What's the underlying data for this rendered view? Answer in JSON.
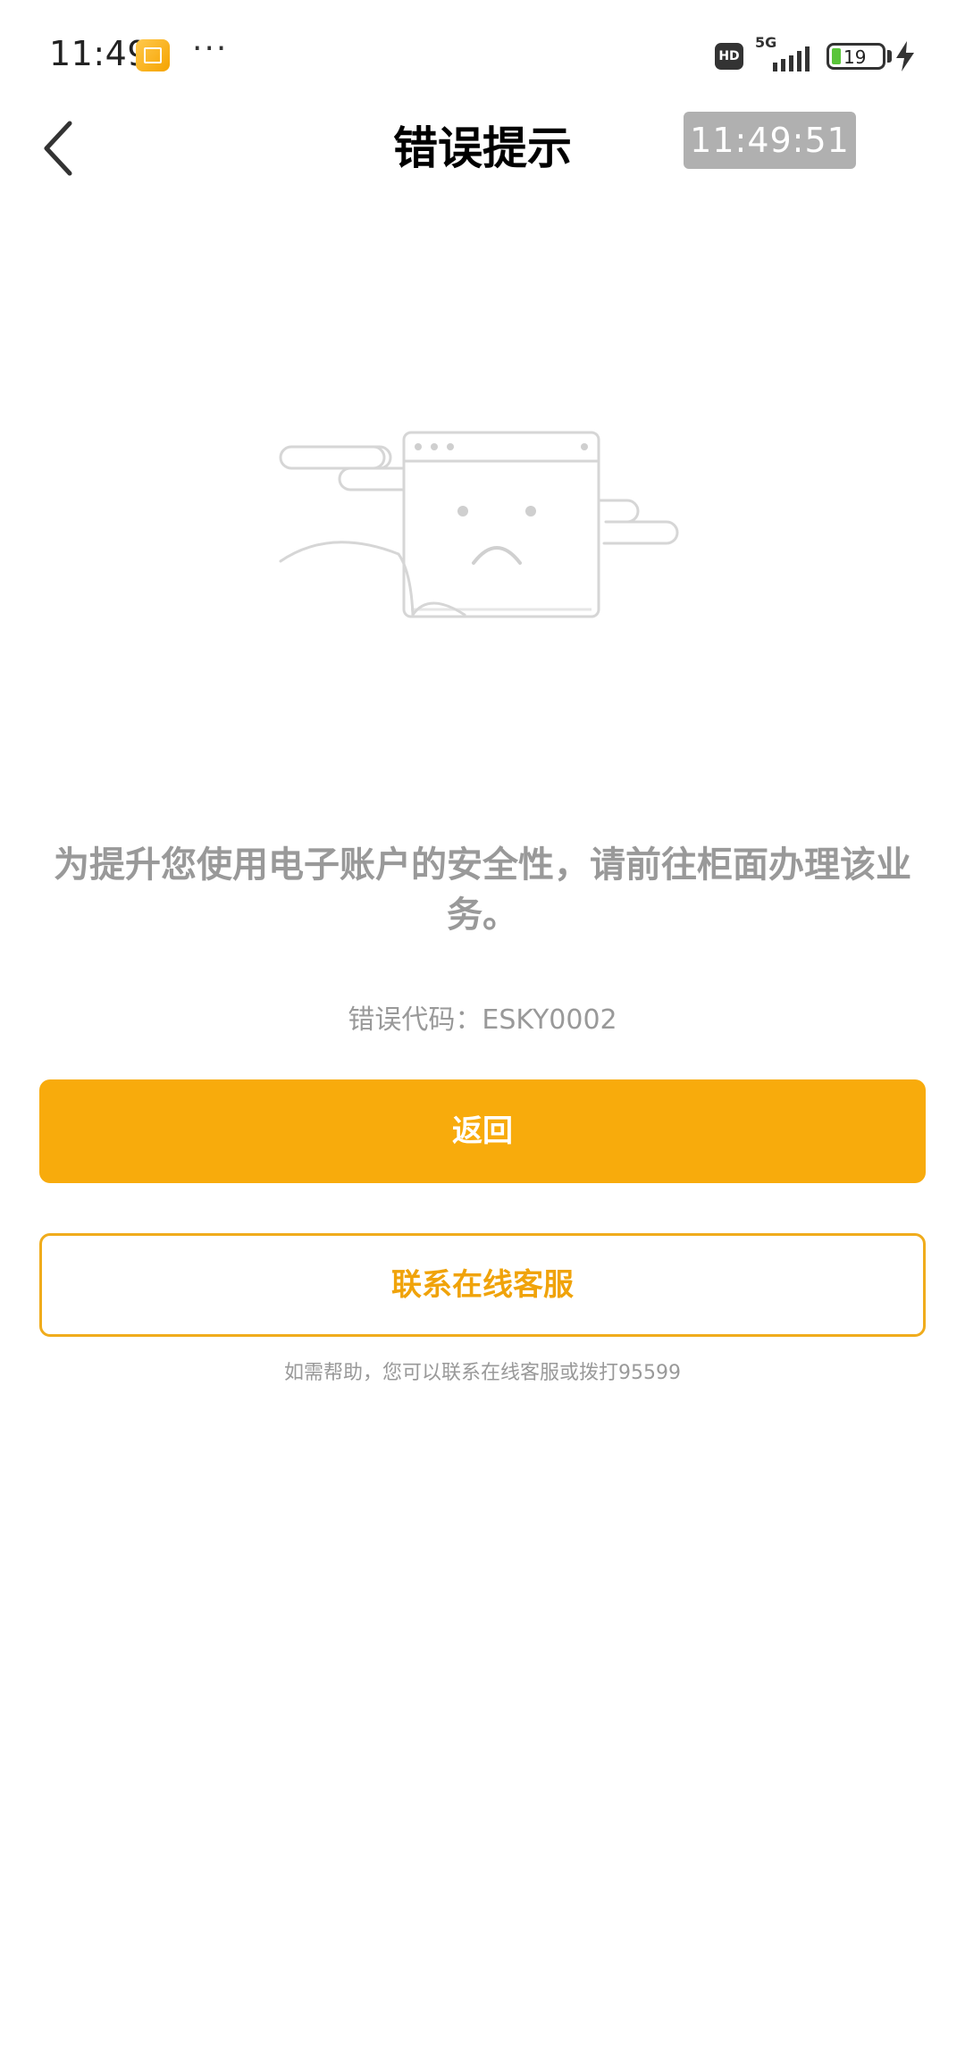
{
  "status_bar": {
    "time": "11:49",
    "more": "···",
    "hd": "HD",
    "network": "5G",
    "battery": "19"
  },
  "nav": {
    "title": "错误提示",
    "clock": "11:49:51"
  },
  "message": "为提升您使用电子账户的安全性，请前往柜面办理该业务。",
  "error_code": "错误代码：ESKY0002",
  "buttons": {
    "back": "返回",
    "contact": "联系在线客服"
  },
  "help_text": "如需帮助，您可以联系在线客服或拨打95599",
  "colors": {
    "accent": "#f8ab0c",
    "muted_text": "#999999",
    "clock_badge": "#b0b0b0"
  },
  "icons": {
    "back": "chevron-left-icon",
    "illustration": "error-window-sad-face-icon"
  }
}
